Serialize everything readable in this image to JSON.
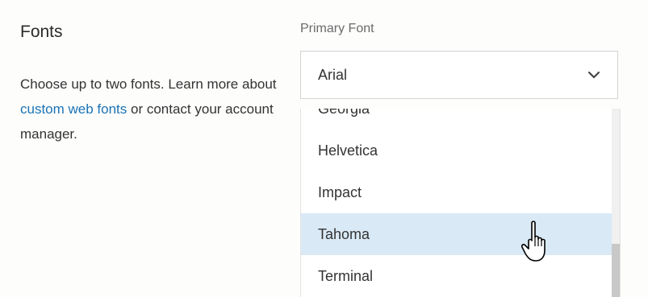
{
  "section": {
    "title": "Fonts",
    "description_before": "Choose up to two fonts. Learn more about ",
    "description_link": "custom web fonts",
    "description_after": " or contact your account manager."
  },
  "primary_font": {
    "label": "Primary Font",
    "selected": "Arial",
    "chevron_icon": "chevron-down-icon"
  },
  "dropdown": {
    "options": [
      "Georgia",
      "Helvetica",
      "Impact",
      "Tahoma",
      "Terminal"
    ],
    "hovered": "Tahoma"
  },
  "colors": {
    "link": "#1a73b5",
    "hover_bg": "#d9e9f5"
  },
  "cursor_icon": "hand-pointer-icon"
}
